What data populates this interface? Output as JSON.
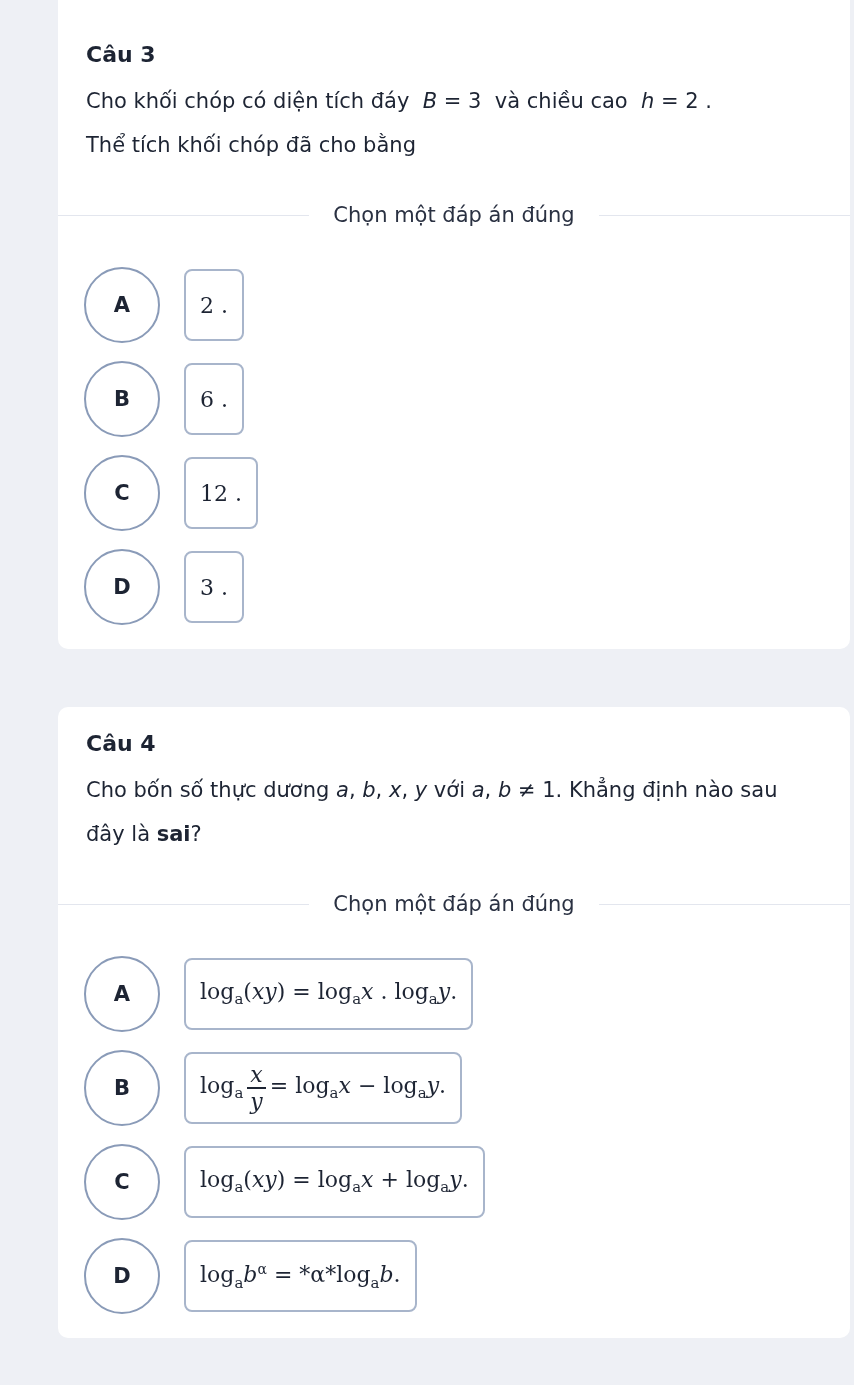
{
  "questions": [
    {
      "title": "Câu 3",
      "text": "Cho khối chóp có diện tích đáy  *B* = 3  và chiều cao  *h* = 2 .\nThể tích khối chóp đã cho bằng",
      "prompt": "Chọn một đáp án đúng",
      "options": [
        {
          "letter": "A",
          "kind": "inline",
          "text": "2 ."
        },
        {
          "letter": "B",
          "kind": "inline",
          "text": "6 ."
        },
        {
          "letter": "C",
          "kind": "inline",
          "text": "12 ."
        },
        {
          "letter": "D",
          "kind": "inline",
          "text": "3 ."
        }
      ]
    },
    {
      "title": "Câu 4",
      "text": "Cho bốn số thực dương *a*, *b*, *x*, *y* với *a*, *b* ≠ 1. Khẳng định nào sau đây là **sai**?",
      "prompt": "Chọn một đáp án đúng",
      "options": [
        {
          "letter": "A",
          "kind": "inline",
          "text": "log$_{a}$(*xy*) = log$_{a}$*x* . log$_{a}$*y*."
        },
        {
          "letter": "B",
          "kind": "fraction",
          "before": "log$_{a}$",
          "numerator": "*x*",
          "denominator": "*y*",
          "after": "= log$_{a}$*x* − log$_{a}$*y*."
        },
        {
          "letter": "C",
          "kind": "inline",
          "text": "log$_{a}$(*xy*) = log$_{a}$*x* + log$_{a}$*y*."
        },
        {
          "letter": "D",
          "kind": "inline",
          "text": "log$_{a}$*b*$^{α}$ = *α*log$_{a}$*b*."
        }
      ]
    }
  ]
}
